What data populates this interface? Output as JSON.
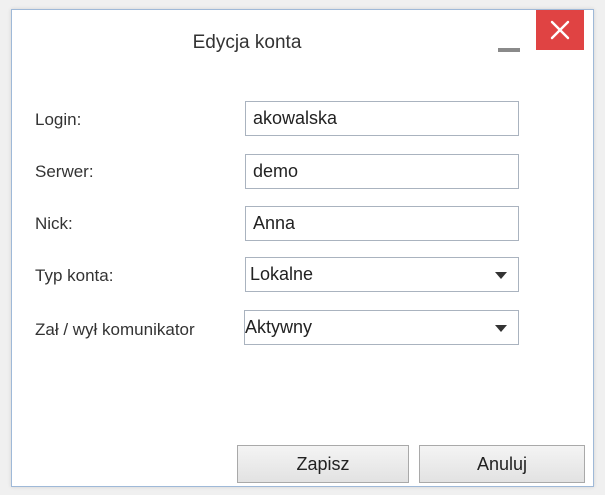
{
  "window": {
    "title": "Edycja konta",
    "minimize_icon": "minimize-icon",
    "close_icon": "close-icon",
    "close_color": "#e04343"
  },
  "form": {
    "login": {
      "label": "Login:",
      "value": "akowalska"
    },
    "server": {
      "label": "Serwer:",
      "value": "demo"
    },
    "nick": {
      "label": "Nick:",
      "value": "Anna"
    },
    "account_type": {
      "label": "Typ konta:",
      "selected": "Lokalne"
    },
    "messenger": {
      "label": "Zał / wył komunikator",
      "selected": "Aktywny"
    }
  },
  "buttons": {
    "save": "Zapisz",
    "cancel": "Anuluj"
  }
}
